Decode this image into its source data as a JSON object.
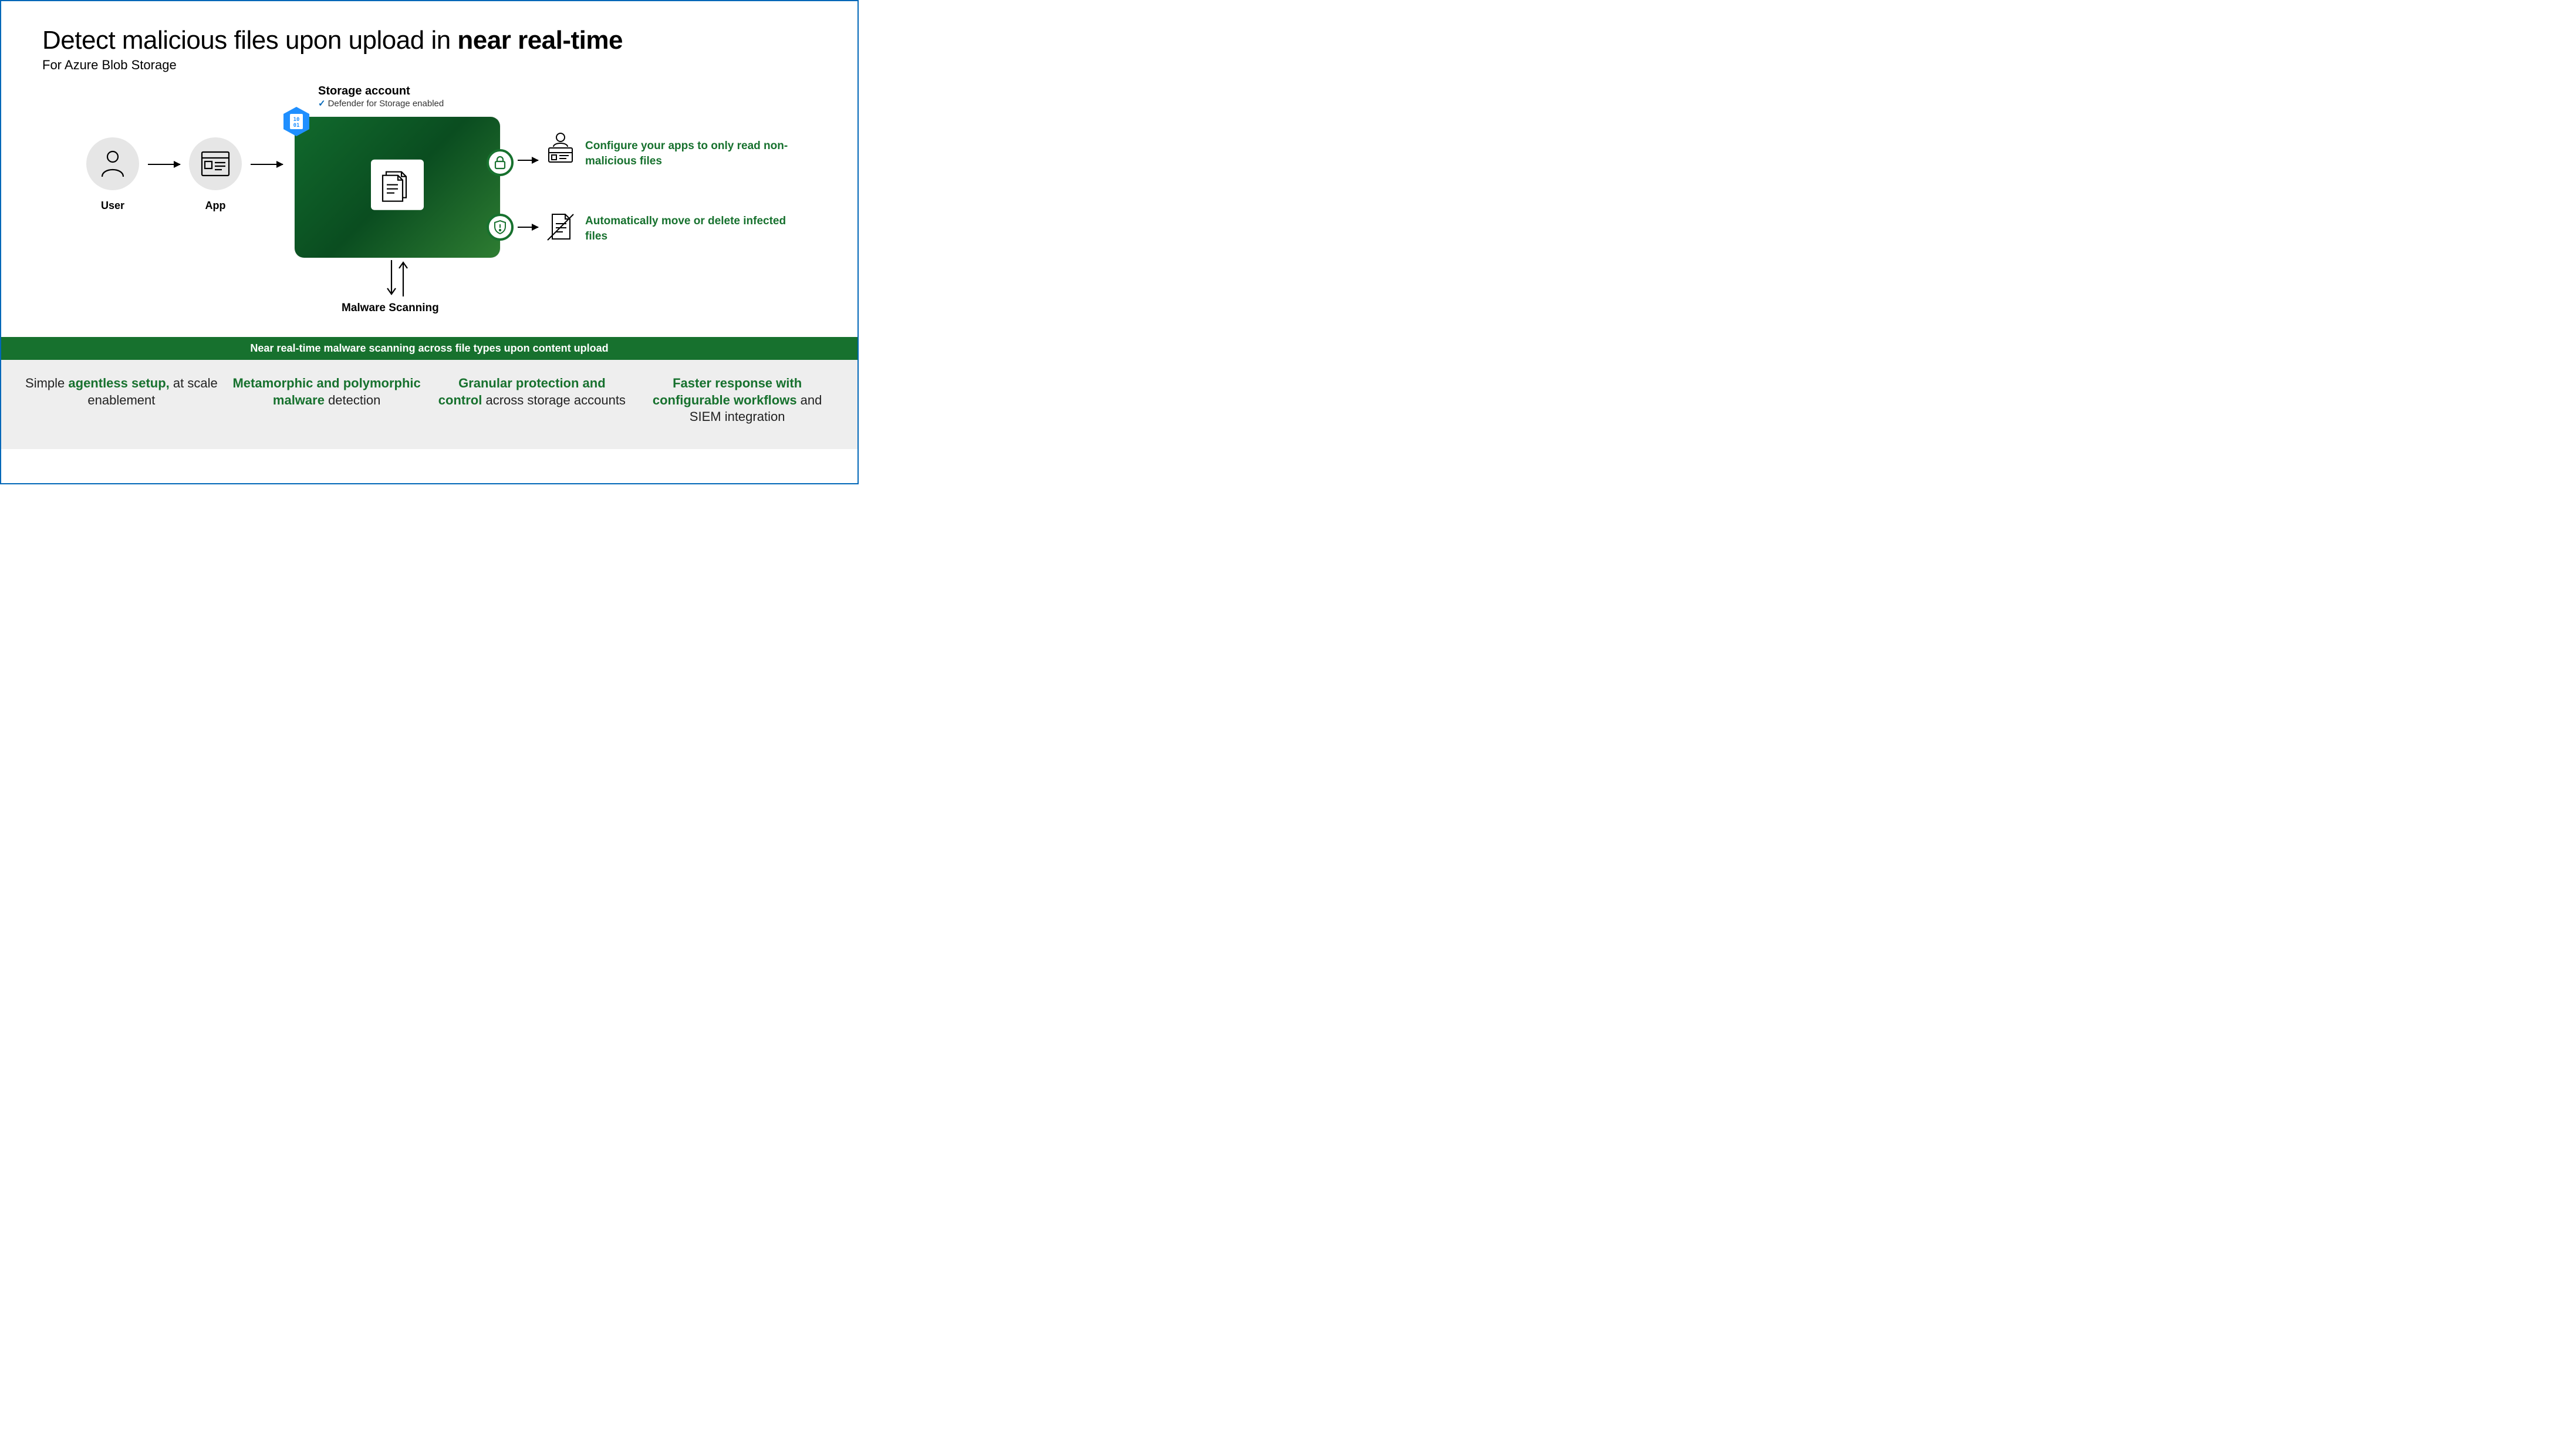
{
  "header": {
    "title_regular": "Detect malicious files upon upload in ",
    "title_bold": "near real-time",
    "subtitle": "For Azure Blob Storage"
  },
  "diagram": {
    "user_label": "User",
    "app_label": "App",
    "storage": {
      "title": "Storage account",
      "status_prefix": "✓",
      "status": "Defender for Storage enabled",
      "hex_text": "10\n01"
    },
    "outcomes": {
      "read_only": "Configure your apps to only read non-malicious files",
      "move_delete": "Automatically move or delete infected files"
    },
    "scan_label": "Malware Scanning"
  },
  "ribbon": "Near real-time malware scanning across file types upon content upload",
  "features": [
    {
      "pre": "Simple ",
      "hl": "agentless setup,",
      "post": " at scale enablement"
    },
    {
      "pre": "",
      "hl": "Metamorphic and polymorphic malware",
      "post": " detection"
    },
    {
      "pre": "",
      "hl": "Granular protection and control",
      "post": " across storage accounts"
    },
    {
      "pre": "",
      "hl": "Faster response with configurable workflows",
      "post": " and SIEM integration"
    }
  ]
}
